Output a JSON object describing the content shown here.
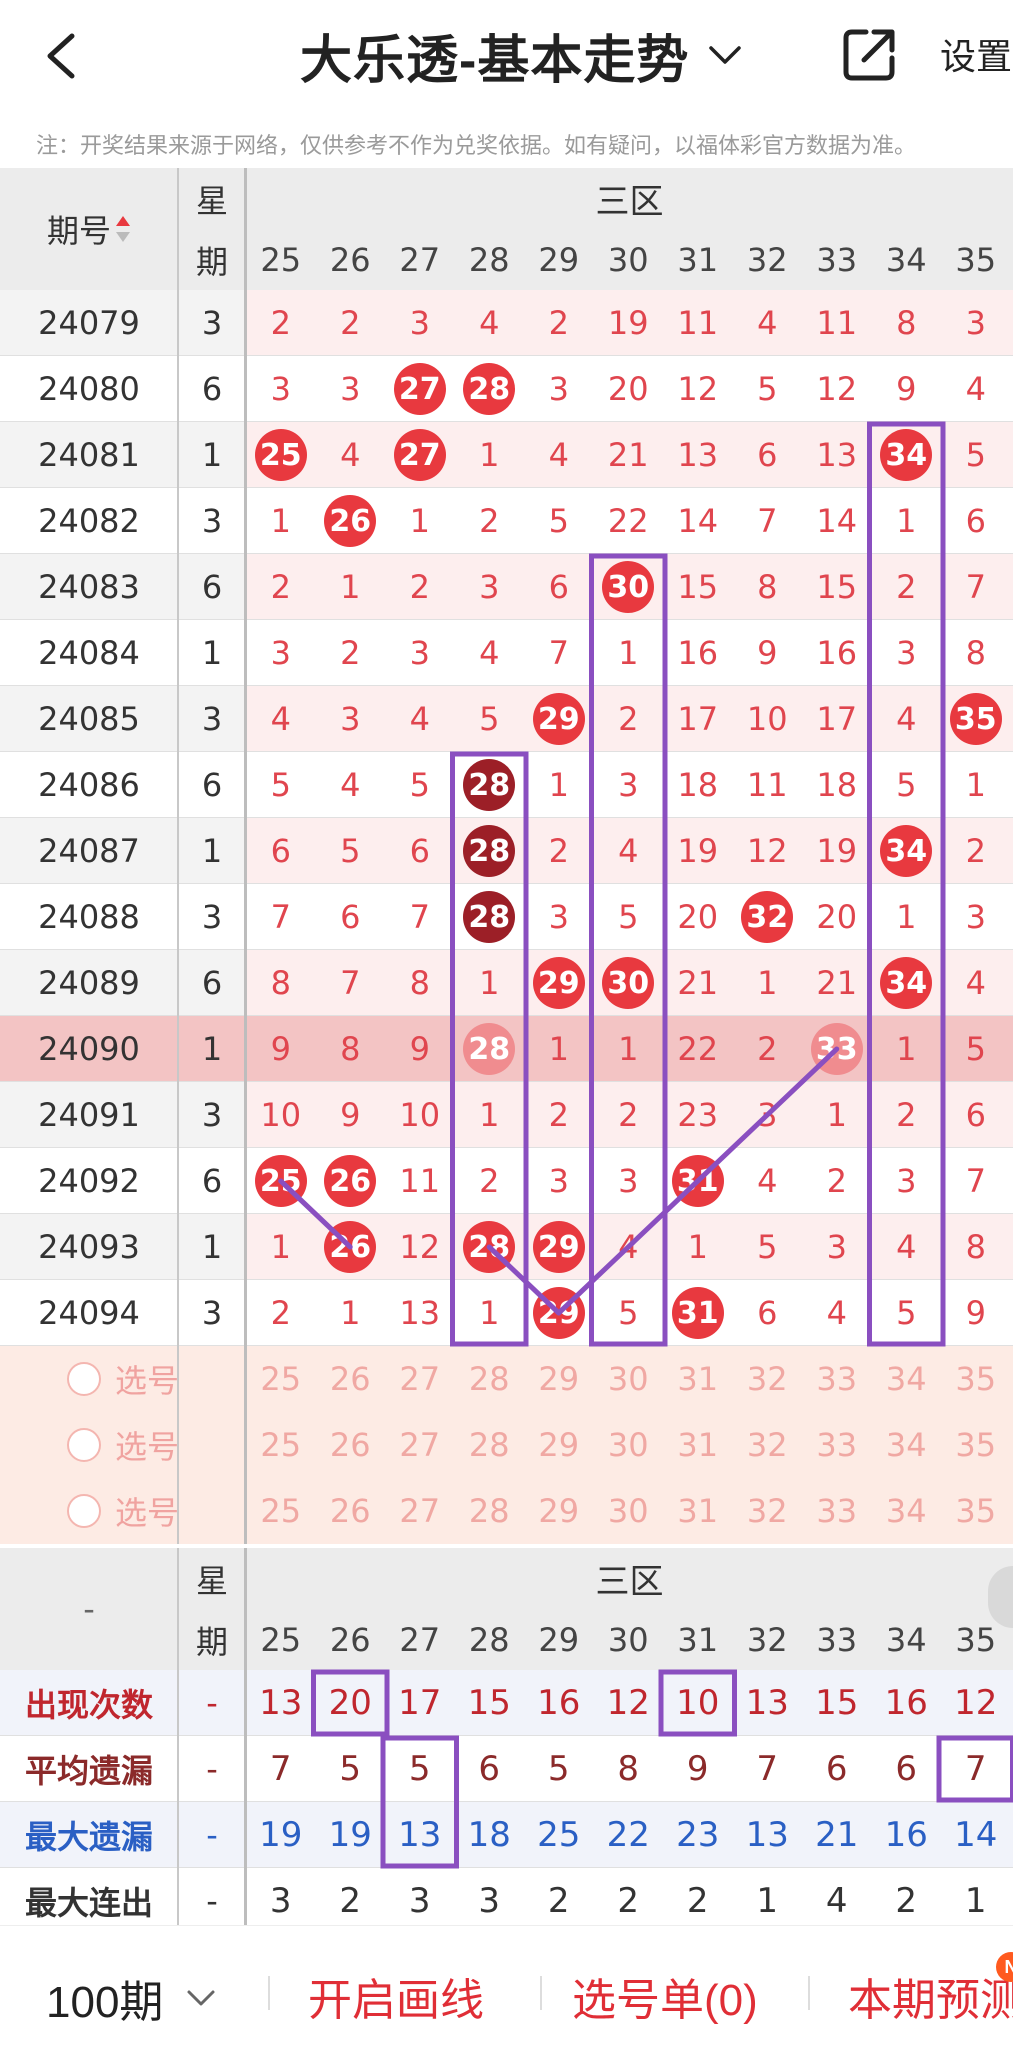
{
  "header": {
    "title": "大乐透-基本走势",
    "settings_label": "设置"
  },
  "notice": "注：开奖结果来源于网络，仅供参考不作为兑奖依据。如有疑问，以福体彩官方数据为准。",
  "table": {
    "issue_header": "期号",
    "week_header_top": "星",
    "week_header_bottom": "期",
    "zone_label": "三区",
    "columns": [
      "25",
      "26",
      "27",
      "28",
      "29",
      "30",
      "31",
      "32",
      "33",
      "34",
      "35"
    ],
    "rows": [
      {
        "issue": "24079",
        "week": "3",
        "cells": [
          {
            "v": "2"
          },
          {
            "v": "2"
          },
          {
            "v": "3"
          },
          {
            "v": "4"
          },
          {
            "v": "2"
          },
          {
            "v": "19"
          },
          {
            "v": "11"
          },
          {
            "v": "4"
          },
          {
            "v": "11"
          },
          {
            "v": "8"
          },
          {
            "v": "3"
          }
        ]
      },
      {
        "issue": "24080",
        "week": "6",
        "cells": [
          {
            "v": "3"
          },
          {
            "v": "3"
          },
          {
            "v": "27",
            "ball": "red"
          },
          {
            "v": "28",
            "ball": "red"
          },
          {
            "v": "3"
          },
          {
            "v": "20"
          },
          {
            "v": "12"
          },
          {
            "v": "5"
          },
          {
            "v": "12"
          },
          {
            "v": "9"
          },
          {
            "v": "4"
          }
        ]
      },
      {
        "issue": "24081",
        "week": "1",
        "cells": [
          {
            "v": "25",
            "ball": "red"
          },
          {
            "v": "4"
          },
          {
            "v": "27",
            "ball": "red"
          },
          {
            "v": "1"
          },
          {
            "v": "4"
          },
          {
            "v": "21"
          },
          {
            "v": "13"
          },
          {
            "v": "6"
          },
          {
            "v": "13"
          },
          {
            "v": "34",
            "ball": "red"
          },
          {
            "v": "5"
          }
        ]
      },
      {
        "issue": "24082",
        "week": "3",
        "cells": [
          {
            "v": "1"
          },
          {
            "v": "26",
            "ball": "red"
          },
          {
            "v": "1"
          },
          {
            "v": "2"
          },
          {
            "v": "5"
          },
          {
            "v": "22"
          },
          {
            "v": "14"
          },
          {
            "v": "7"
          },
          {
            "v": "14"
          },
          {
            "v": "1"
          },
          {
            "v": "6"
          }
        ]
      },
      {
        "issue": "24083",
        "week": "6",
        "cells": [
          {
            "v": "2"
          },
          {
            "v": "1"
          },
          {
            "v": "2"
          },
          {
            "v": "3"
          },
          {
            "v": "6"
          },
          {
            "v": "30",
            "ball": "red"
          },
          {
            "v": "15"
          },
          {
            "v": "8"
          },
          {
            "v": "15"
          },
          {
            "v": "2"
          },
          {
            "v": "7"
          }
        ]
      },
      {
        "issue": "24084",
        "week": "1",
        "cells": [
          {
            "v": "3"
          },
          {
            "v": "2"
          },
          {
            "v": "3"
          },
          {
            "v": "4"
          },
          {
            "v": "7"
          },
          {
            "v": "1"
          },
          {
            "v": "16"
          },
          {
            "v": "9"
          },
          {
            "v": "16"
          },
          {
            "v": "3"
          },
          {
            "v": "8"
          }
        ]
      },
      {
        "issue": "24085",
        "week": "3",
        "cells": [
          {
            "v": "4"
          },
          {
            "v": "3"
          },
          {
            "v": "4"
          },
          {
            "v": "5"
          },
          {
            "v": "29",
            "ball": "red"
          },
          {
            "v": "2"
          },
          {
            "v": "17"
          },
          {
            "v": "10"
          },
          {
            "v": "17"
          },
          {
            "v": "4"
          },
          {
            "v": "35",
            "ball": "red"
          }
        ]
      },
      {
        "issue": "24086",
        "week": "6",
        "cells": [
          {
            "v": "5"
          },
          {
            "v": "4"
          },
          {
            "v": "5"
          },
          {
            "v": "28",
            "ball": "dark"
          },
          {
            "v": "1"
          },
          {
            "v": "3"
          },
          {
            "v": "18"
          },
          {
            "v": "11"
          },
          {
            "v": "18"
          },
          {
            "v": "5"
          },
          {
            "v": "1"
          }
        ]
      },
      {
        "issue": "24087",
        "week": "1",
        "cells": [
          {
            "v": "6"
          },
          {
            "v": "5"
          },
          {
            "v": "6"
          },
          {
            "v": "28",
            "ball": "dark"
          },
          {
            "v": "2"
          },
          {
            "v": "4"
          },
          {
            "v": "19"
          },
          {
            "v": "12"
          },
          {
            "v": "19"
          },
          {
            "v": "34",
            "ball": "red"
          },
          {
            "v": "2"
          }
        ]
      },
      {
        "issue": "24088",
        "week": "3",
        "cells": [
          {
            "v": "7"
          },
          {
            "v": "6"
          },
          {
            "v": "7"
          },
          {
            "v": "28",
            "ball": "dark"
          },
          {
            "v": "3"
          },
          {
            "v": "5"
          },
          {
            "v": "20"
          },
          {
            "v": "32",
            "ball": "red"
          },
          {
            "v": "20"
          },
          {
            "v": "1"
          },
          {
            "v": "3"
          }
        ]
      },
      {
        "issue": "24089",
        "week": "6",
        "cells": [
          {
            "v": "8"
          },
          {
            "v": "7"
          },
          {
            "v": "8"
          },
          {
            "v": "1"
          },
          {
            "v": "29",
            "ball": "red"
          },
          {
            "v": "30",
            "ball": "red"
          },
          {
            "v": "21"
          },
          {
            "v": "1"
          },
          {
            "v": "21"
          },
          {
            "v": "34",
            "ball": "red"
          },
          {
            "v": "4"
          }
        ]
      },
      {
        "issue": "24090",
        "week": "1",
        "highlight": true,
        "cells": [
          {
            "v": "9"
          },
          {
            "v": "8"
          },
          {
            "v": "9"
          },
          {
            "v": "28",
            "ball": "faded"
          },
          {
            "v": "1"
          },
          {
            "v": "1"
          },
          {
            "v": "22"
          },
          {
            "v": "2"
          },
          {
            "v": "33",
            "ball": "faded"
          },
          {
            "v": "1"
          },
          {
            "v": "5"
          }
        ]
      },
      {
        "issue": "24091",
        "week": "3",
        "cells": [
          {
            "v": "10"
          },
          {
            "v": "9"
          },
          {
            "v": "10"
          },
          {
            "v": "1"
          },
          {
            "v": "2"
          },
          {
            "v": "2"
          },
          {
            "v": "23"
          },
          {
            "v": "3"
          },
          {
            "v": "1"
          },
          {
            "v": "2"
          },
          {
            "v": "6"
          }
        ]
      },
      {
        "issue": "24092",
        "week": "6",
        "cells": [
          {
            "v": "25",
            "ball": "red"
          },
          {
            "v": "26",
            "ball": "red"
          },
          {
            "v": "11"
          },
          {
            "v": "2"
          },
          {
            "v": "3"
          },
          {
            "v": "3"
          },
          {
            "v": "31",
            "ball": "red"
          },
          {
            "v": "4"
          },
          {
            "v": "2"
          },
          {
            "v": "3"
          },
          {
            "v": "7"
          }
        ]
      },
      {
        "issue": "24093",
        "week": "1",
        "cells": [
          {
            "v": "1"
          },
          {
            "v": "26",
            "ball": "red"
          },
          {
            "v": "12"
          },
          {
            "v": "28",
            "ball": "red"
          },
          {
            "v": "29",
            "ball": "red"
          },
          {
            "v": "4"
          },
          {
            "v": "1"
          },
          {
            "v": "5"
          },
          {
            "v": "3"
          },
          {
            "v": "4"
          },
          {
            "v": "8"
          }
        ]
      },
      {
        "issue": "24094",
        "week": "3",
        "cells": [
          {
            "v": "2"
          },
          {
            "v": "1"
          },
          {
            "v": "13"
          },
          {
            "v": "1"
          },
          {
            "v": "29",
            "ball": "red"
          },
          {
            "v": "5"
          },
          {
            "v": "31",
            "ball": "red"
          },
          {
            "v": "6"
          },
          {
            "v": "4"
          },
          {
            "v": "5"
          },
          {
            "v": "9"
          }
        ]
      }
    ],
    "pick_rows": [
      {
        "label": "选号"
      },
      {
        "label": "选号"
      },
      {
        "label": "选号"
      }
    ]
  },
  "stats": {
    "dash": "-",
    "week_header_top": "星",
    "week_header_bottom": "期",
    "zone_label": "三区",
    "rows": [
      {
        "label": "出现次数",
        "week": "-",
        "color": "#c0262e",
        "num_color": "#c0262e",
        "values": [
          "13",
          "20",
          "17",
          "15",
          "16",
          "12",
          "10",
          "13",
          "15",
          "16",
          "12"
        ]
      },
      {
        "label": "平均遗漏",
        "week": "-",
        "color": "#8b2a2a",
        "num_color": "#8b2a2a",
        "values": [
          "7",
          "5",
          "5",
          "6",
          "5",
          "8",
          "9",
          "7",
          "6",
          "6",
          "7"
        ]
      },
      {
        "label": "最大遗漏",
        "week": "-",
        "color": "#2a5fc4",
        "num_color": "#2a5fc4",
        "values": [
          "19",
          "19",
          "13",
          "18",
          "25",
          "22",
          "23",
          "13",
          "21",
          "16",
          "14"
        ]
      },
      {
        "label": "最大连出",
        "week": "-",
        "color": "#333333",
        "num_color": "#333333",
        "values": [
          "3",
          "2",
          "3",
          "3",
          "2",
          "2",
          "2",
          "1",
          "4",
          "2",
          "1"
        ]
      }
    ]
  },
  "bottom_bar": {
    "period": "100期",
    "draw_line": "开启画线",
    "pick_list": "选号单(0)",
    "prediction": "本期预测",
    "badge": "N"
  },
  "colors": {
    "ball_red": "#e8393f",
    "ball_dark": "#9c1f27",
    "annotation": "#8a4fc0",
    "highlight_row": "#f3c4c4",
    "light_row": "#fdeeee"
  }
}
